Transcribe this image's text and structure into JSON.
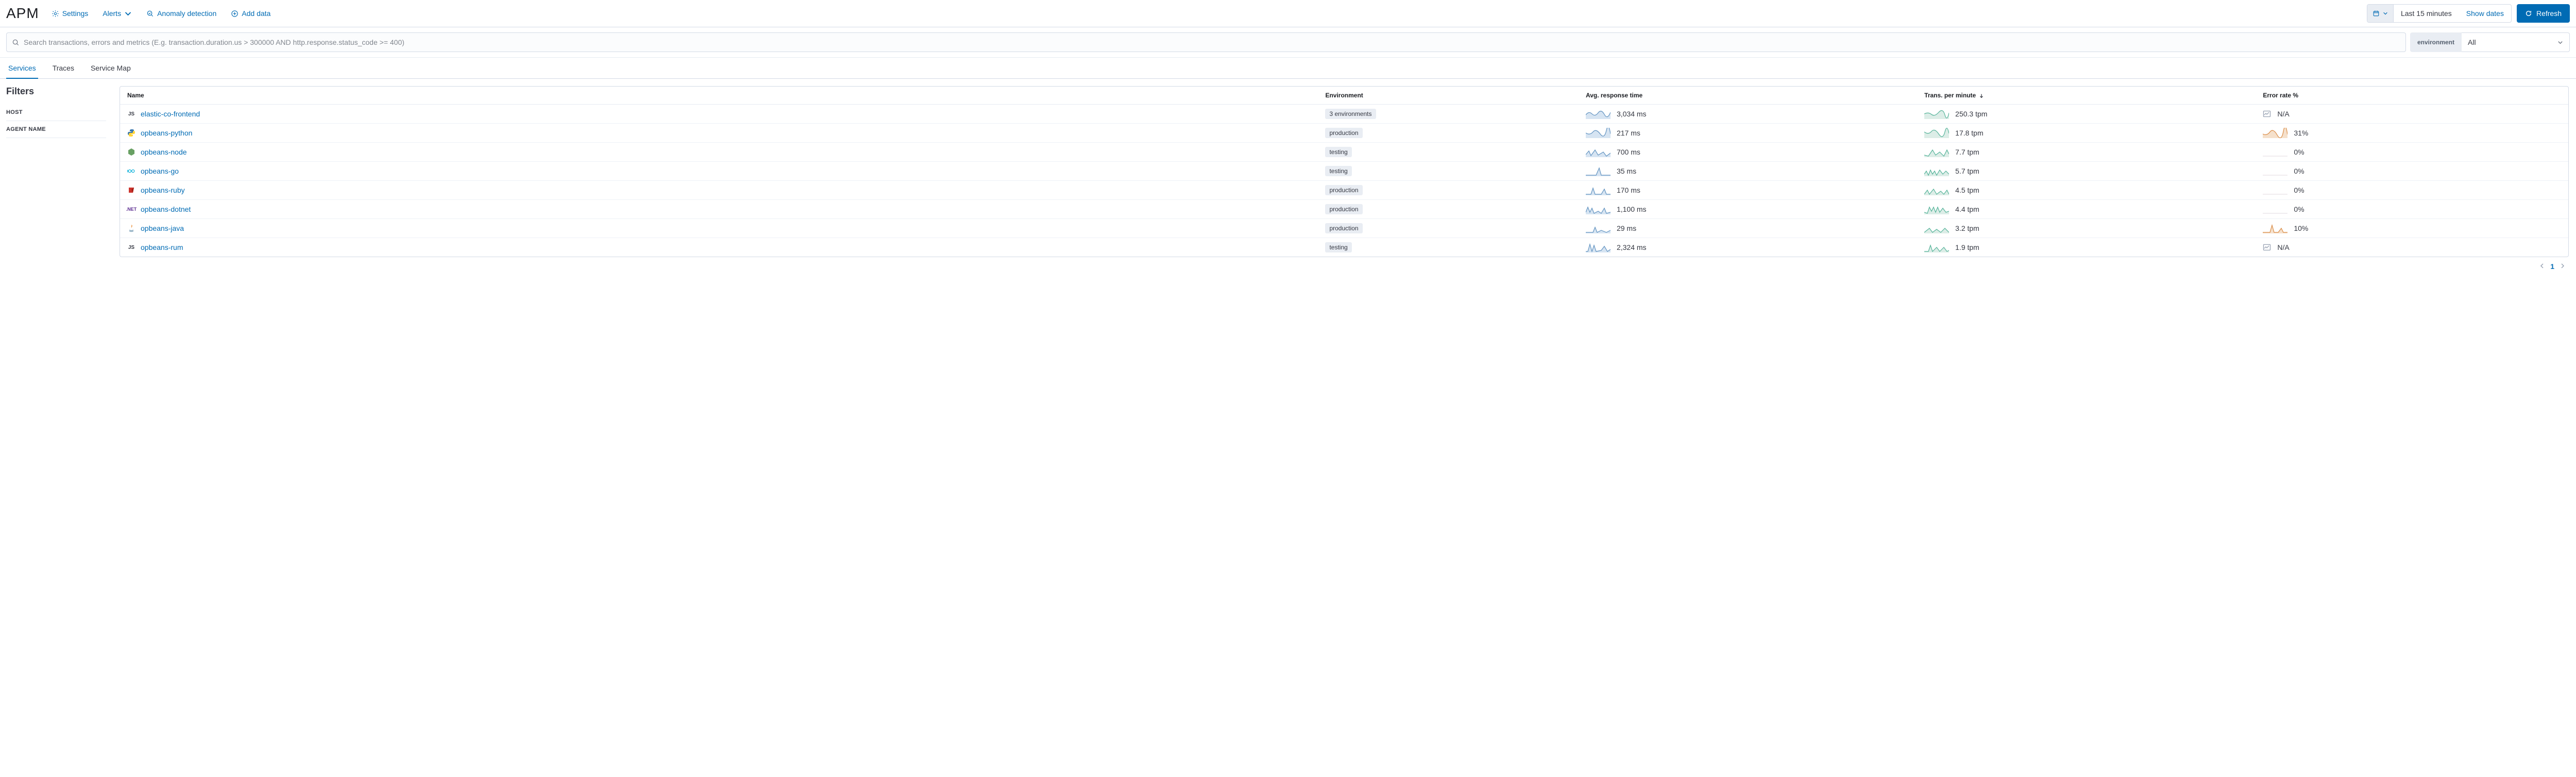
{
  "header": {
    "title": "APM",
    "links": {
      "settings": "Settings",
      "alerts": "Alerts",
      "anomaly": "Anomaly detection",
      "add_data": "Add data"
    },
    "timerange": "Last 15 minutes",
    "show_dates": "Show dates",
    "refresh": "Refresh"
  },
  "search": {
    "placeholder": "Search transactions, errors and metrics (E.g. transaction.duration.us > 300000 AND http.response.status_code >= 400)",
    "env_label": "environment",
    "env_value": "All"
  },
  "tabs": {
    "services": "Services",
    "traces": "Traces",
    "service_map": "Service Map"
  },
  "filters": {
    "heading": "Filters",
    "host": "HOST",
    "agent": "AGENT NAME"
  },
  "table": {
    "cols": {
      "name": "Name",
      "environment": "Environment",
      "avg_response": "Avg. response time",
      "tpm": "Trans. per minute",
      "error_rate": "Error rate %"
    },
    "rows": [
      {
        "agent": "js",
        "name": "elastic-co-frontend",
        "env": "3 environments",
        "env_badge": true,
        "avg": "3,034 ms",
        "tpm": "250.3 tpm",
        "err": "N/A",
        "err_spark": "na"
      },
      {
        "agent": "python",
        "name": "opbeans-python",
        "env": "production",
        "avg": "217 ms",
        "tpm": "17.8 tpm",
        "err": "31%",
        "err_spark": "orange"
      },
      {
        "agent": "node",
        "name": "opbeans-node",
        "env": "testing",
        "avg": "700 ms",
        "tpm": "7.7 tpm",
        "err": "0%",
        "err_spark": "empty"
      },
      {
        "agent": "go",
        "name": "opbeans-go",
        "env": "testing",
        "avg": "35 ms",
        "tpm": "5.7 tpm",
        "err": "0%",
        "err_spark": "empty"
      },
      {
        "agent": "ruby",
        "name": "opbeans-ruby",
        "env": "production",
        "avg": "170 ms",
        "tpm": "4.5 tpm",
        "err": "0%",
        "err_spark": "empty"
      },
      {
        "agent": "dotnet",
        "name": "opbeans-dotnet",
        "env": "production",
        "avg": "1,100 ms",
        "tpm": "4.4 tpm",
        "err": "0%",
        "err_spark": "empty"
      },
      {
        "agent": "java",
        "name": "opbeans-java",
        "env": "production",
        "avg": "29 ms",
        "tpm": "3.2 tpm",
        "err": "10%",
        "err_spark": "orange2"
      },
      {
        "agent": "js",
        "name": "opbeans-rum",
        "env": "testing",
        "avg": "2,324 ms",
        "tpm": "1.9 tpm",
        "err": "N/A",
        "err_spark": "na"
      }
    ]
  },
  "pagination": {
    "page": "1"
  }
}
